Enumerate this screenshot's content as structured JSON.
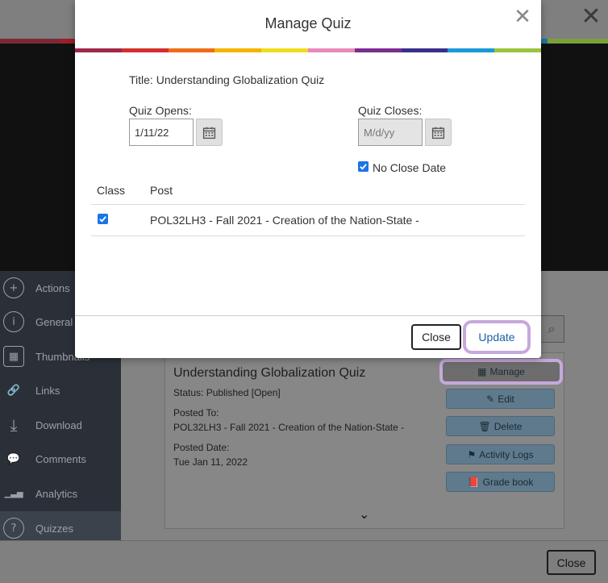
{
  "background": {
    "stripe_colors": [
      "#7a2a36",
      "#9a1f2a",
      "#a34b1e",
      "#a8781a",
      "#a8a01e",
      "#a86a8a",
      "#5a2a7a",
      "#2a2a6a",
      "#1a7aa0",
      "#7aa03a"
    ],
    "sidebar": {
      "items": [
        {
          "label": "Actions",
          "icon": "plus-icon",
          "glyph": "+"
        },
        {
          "label": "General",
          "icon": "info-icon",
          "glyph": "i"
        },
        {
          "label": "Thumbnails",
          "icon": "thumbnails-icon",
          "glyph": "▦"
        },
        {
          "label": "Links",
          "icon": "link-icon",
          "glyph": "🔗"
        },
        {
          "label": "Download",
          "icon": "download-icon",
          "glyph": "⤓"
        },
        {
          "label": "Comments",
          "icon": "comments-icon",
          "glyph": "💬"
        },
        {
          "label": "Analytics",
          "icon": "analytics-icon",
          "glyph": "▁▃▅"
        },
        {
          "label": "Quizzes",
          "icon": "question-icon",
          "glyph": "?"
        }
      ]
    },
    "card": {
      "title": "Understanding Globalization Quiz",
      "status_label": "Status:",
      "status_value": "Published [Open]",
      "posted_to_label": "Posted To:",
      "posted_to_value": "POL32LH3 - Fall 2021 - Creation of the Nation-State -",
      "posted_date_label": "Posted Date:",
      "posted_date_value": "Tue Jan 11, 2022",
      "buttons": {
        "manage": "Manage",
        "edit": "Edit",
        "delete": "Delete",
        "activity_logs": "Activity Logs",
        "grade_book": "Grade book"
      }
    },
    "footer_close": "Close"
  },
  "modal": {
    "title": "Manage Quiz",
    "rainbow_colors": [
      "#a0284a",
      "#d32f2f",
      "#ef6c1a",
      "#f5b400",
      "#f0dc1e",
      "#e88ab8",
      "#7b2d8e",
      "#3a2f8a",
      "#1a9ad6",
      "#9ac43c"
    ],
    "quiz_title": "Title: Understanding Globalization Quiz",
    "quiz_opens_label": "Quiz Opens:",
    "quiz_opens_value": "1/11/22",
    "quiz_closes_label": "Quiz Closes:",
    "quiz_closes_placeholder": "M/d/yy",
    "no_close_date_label": "No Close Date",
    "no_close_date_checked": true,
    "table": {
      "headers": [
        "Class",
        "Post"
      ],
      "rows": [
        {
          "checked": true,
          "post": "POL32LH3 - Fall 2021 - Creation of the Nation-State -"
        }
      ]
    },
    "close_label": "Close",
    "update_label": "Update"
  }
}
